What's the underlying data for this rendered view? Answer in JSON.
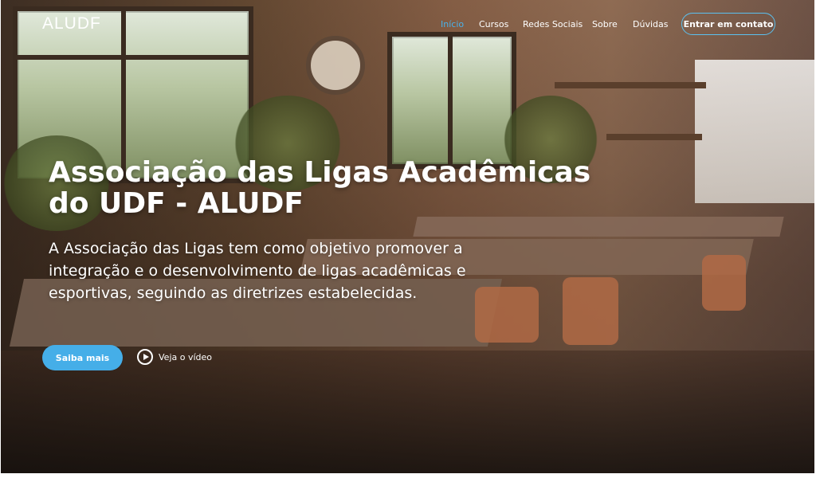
{
  "brand": {
    "logo": "ALUDF"
  },
  "nav": {
    "items": [
      "Início",
      "Cursos",
      "Redes Sociais",
      "Sobre",
      "Dúvidas"
    ],
    "active_index": 0,
    "contact_label": "Entrar em contato"
  },
  "hero": {
    "title_line1": "Associação das Ligas Acadêmicas",
    "title_line2": "do UDF - ALUDF",
    "subtitle_line1": "A Associação das Ligas tem como objetivo promover a",
    "subtitle_line2": "integração e o desenvolvimento de ligas acadêmicas e",
    "subtitle_line3": "esportivas, seguindo as diretrizes estabelecidas.",
    "primary_button": "Saiba mais",
    "video_link": "Veja o vídeo"
  },
  "colors": {
    "accent": "#45aee8",
    "active_nav": "#49b2eb",
    "outline": "#5bc1f0",
    "text": "#ffffff"
  },
  "icons": {
    "video": "play-circle-icon"
  }
}
